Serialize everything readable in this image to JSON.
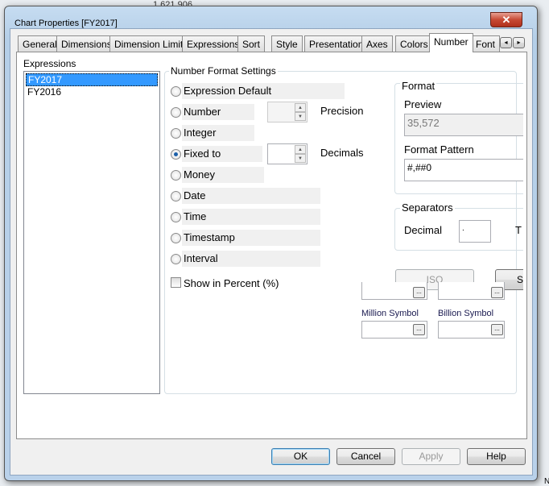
{
  "background_text": "1,621,906",
  "window": {
    "title": "Chart Properties [FY2017]",
    "close_glyph": "✕"
  },
  "tabs": [
    "General",
    "Dimensions",
    "Dimension Limits",
    "Expressions",
    "Sort",
    "Style",
    "Presentation",
    "Axes",
    "Colors",
    "Number",
    "Font"
  ],
  "active_tab": "Number",
  "tab_scroll": {
    "left": "◂",
    "right": "▸"
  },
  "expressions": {
    "label": "Expressions",
    "items": [
      "FY2017",
      "FY2016"
    ],
    "selected": "FY2017"
  },
  "number_format": {
    "group_label": "Number Format Settings",
    "options": [
      "Expression Default",
      "Number",
      "Integer",
      "Fixed to",
      "Money",
      "Date",
      "Time",
      "Timestamp",
      "Interval"
    ],
    "selected": "Fixed to",
    "precision_label": "Precision",
    "precision_value": "",
    "decimals_label": "Decimals",
    "decimals_value": "",
    "show_in_percent": {
      "label": "Show in Percent (%)",
      "checked": false
    }
  },
  "format": {
    "group_label": "Format",
    "preview_label": "Preview",
    "preview_value": "35,572",
    "pattern_label": "Format Pattern",
    "pattern_value": "#,##0"
  },
  "separators": {
    "group_label": "Separators",
    "decimal_label": "Decimal",
    "decimal_value": ".",
    "thousand_label_partial": "T"
  },
  "buttons": {
    "iso": "ISO",
    "s_partial": "S",
    "ok": "OK",
    "cancel": "Cancel",
    "apply": "Apply",
    "help": "Help",
    "browse": "..."
  },
  "symbols": {
    "million_label": "Million Symbol",
    "billion_label": "Billion Symbol"
  },
  "corner_text": "N"
}
